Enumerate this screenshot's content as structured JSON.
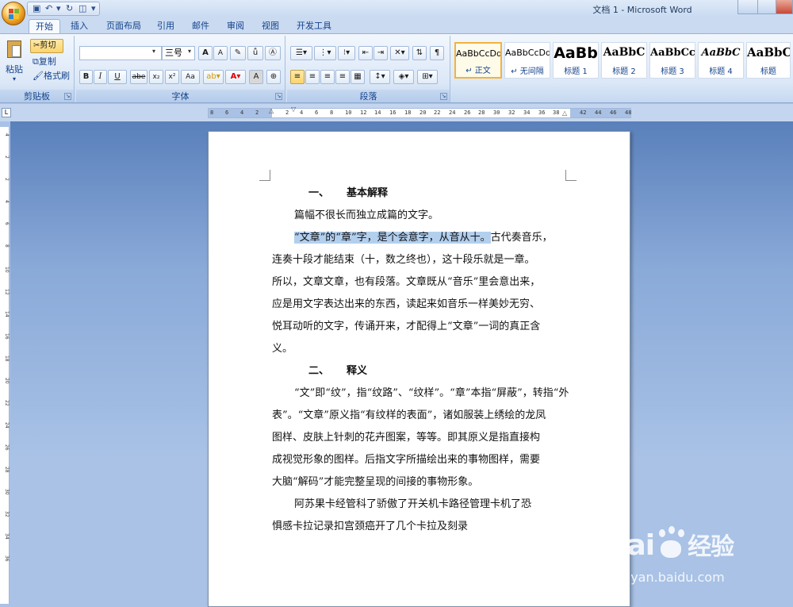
{
  "window": {
    "title": "文档 1 - Microsoft Word"
  },
  "tabs": [
    "开始",
    "插入",
    "页面布局",
    "引用",
    "邮件",
    "审阅",
    "视图",
    "开发工具"
  ],
  "clipboard": {
    "paste": "粘贴",
    "cut": "剪切",
    "copy": "复制",
    "format_painter": "格式刷",
    "label": "剪贴板"
  },
  "font": {
    "name_value": "",
    "size_value": "三号",
    "label": "字体",
    "bold": "B",
    "italic": "I",
    "underline": "U",
    "strike": "abe",
    "subscript": "x₂",
    "superscript": "x²",
    "case": "Aa",
    "grow": "A",
    "shrink": "A"
  },
  "paragraph": {
    "label": "段落"
  },
  "styles": [
    {
      "sample": "AaBbCcDd",
      "name": "正文"
    },
    {
      "sample": "AaBbCcDd",
      "name": "无间隔"
    },
    {
      "sample": "AaBb",
      "name": "标题 1"
    },
    {
      "sample": "AaBbC",
      "name": "标题 2"
    },
    {
      "sample": "AaBbCc",
      "name": "标题 3"
    },
    {
      "sample": "AaBbC",
      "name": "标题 4"
    },
    {
      "sample": "AaBbC",
      "name": "标题"
    }
  ],
  "ruler": {
    "h_ticks": [
      "8",
      "6",
      "4",
      "2",
      "2",
      "4",
      "6",
      "8",
      "10",
      "12",
      "14",
      "16",
      "18",
      "20",
      "22",
      "24",
      "26",
      "28",
      "30",
      "32",
      "34",
      "36",
      "38",
      "42",
      "44",
      "46",
      "48"
    ],
    "v_ticks": [
      "4",
      "2",
      "2",
      "4",
      "6",
      "8",
      "10",
      "12",
      "14",
      "16",
      "18",
      "20",
      "22",
      "24",
      "26",
      "28",
      "30",
      "32",
      "34",
      "36"
    ]
  },
  "document": {
    "heading1_num": "一、",
    "heading1": "基本解释",
    "p1": "篇幅不很长而独立成篇的文字。",
    "p2_hl": "“文章”的“章”字，是个会意字，从音从十。",
    "p2_rest": "古代奏音乐，",
    "p2_lines": [
      "连奏十段才能结束（十，数之终也），这十段乐就是一章。",
      "所以，文章文章，也有段落。文章既从“音乐”里会意出来，",
      "应是用文字表达出来的东西，读起来如音乐一样美妙无穷、",
      "悦耳动听的文字，传诵开来，才配得上“文章”一词的真正含",
      "义。"
    ],
    "heading2_num": "二、",
    "heading2": "释义",
    "p3_lines": [
      "“文”即“纹”，指“纹路”、“纹样”。“章”本指“屏蔽”，转指“外",
      "表”。“文章”原义指“有纹样的表面”，诸如服装上绣绘的龙凤",
      "图样、皮肤上针刺的花卉图案，等等。即其原义是指直接构",
      "成视觉形象的图样。后指文字所描绘出来的事物图样，需要",
      "大脑“解码”才能完整呈现的间接的事物形象。"
    ],
    "p4_lines": [
      "阿苏果卡经管科了骄傲了开关机卡路径管理卡机了恐",
      "惧感卡拉记录扣宫颈癌开了几个卡拉及刻录"
    ]
  },
  "watermark": {
    "brand": "Bai",
    "brand2": "经验",
    "url": "jingyan.baidu.com"
  }
}
